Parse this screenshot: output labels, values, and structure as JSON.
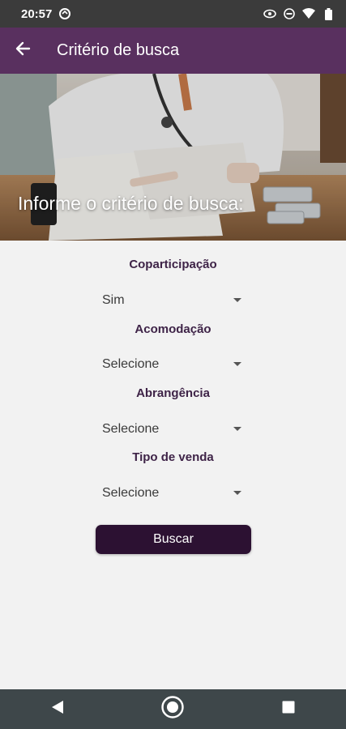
{
  "status_bar": {
    "time": "20:57"
  },
  "app_bar": {
    "title": "Critério de busca"
  },
  "hero": {
    "heading": "Informe o critério de busca:"
  },
  "form": {
    "fields": [
      {
        "label": "Coparticipação",
        "value": "Sim"
      },
      {
        "label": "Acomodação",
        "value": "Selecione"
      },
      {
        "label": "Abrangência",
        "value": "Selecione"
      },
      {
        "label": "Tipo de venda",
        "value": "Selecione"
      }
    ],
    "submit_label": "Buscar"
  },
  "colors": {
    "app_bar": "#59305f",
    "button": "#2c1132",
    "label": "#3e2347"
  }
}
